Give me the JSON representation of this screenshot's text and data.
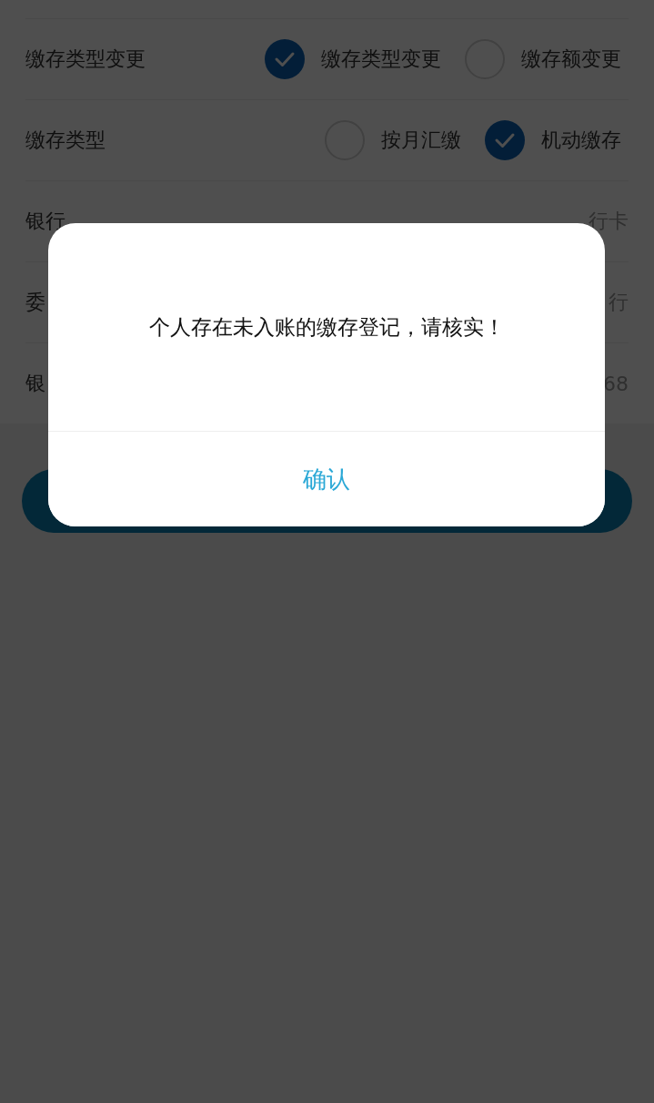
{
  "form": {
    "rows": [
      {
        "kind": "radio",
        "label": "缴存类型变更",
        "options": [
          {
            "label": "缴存类型变更",
            "selected": true
          },
          {
            "label": "缴存额变更",
            "selected": false
          }
        ]
      },
      {
        "kind": "radio",
        "label": "缴存类型",
        "options": [
          {
            "label": "按月汇缴",
            "selected": false
          },
          {
            "label": "机动缴存",
            "selected": true
          }
        ]
      },
      {
        "kind": "value",
        "label": "银行",
        "value": "行卡"
      },
      {
        "kind": "value",
        "label": "委",
        "value": "行"
      },
      {
        "kind": "value",
        "label": "银",
        "value": "68"
      }
    ]
  },
  "dialog": {
    "message": "个人存在未入账的缴存登记，请核实！",
    "confirm": "确认"
  }
}
